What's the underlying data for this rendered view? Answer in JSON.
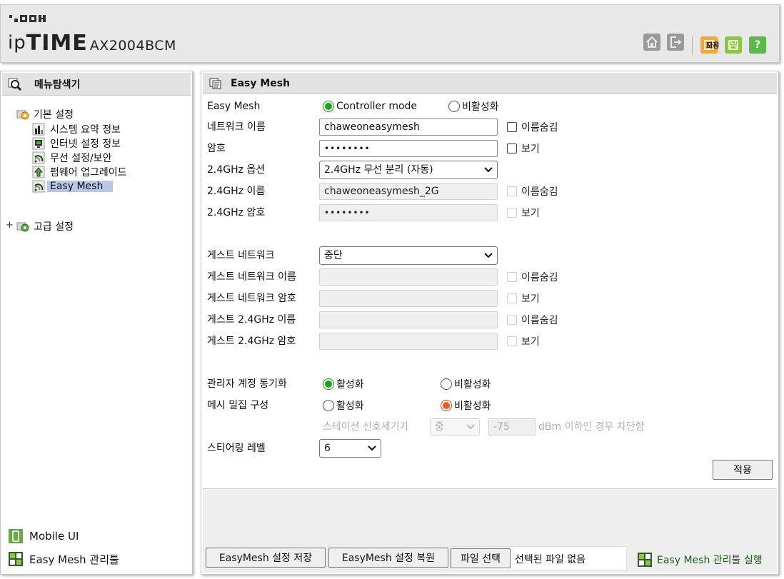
{
  "header": {
    "brand": "ipTIME",
    "brand_ip": "ip",
    "brand_time": "TIME",
    "model": "AX2004BCM",
    "nav_icons": [
      "home-icon",
      "logout-icon"
    ],
    "actions": [
      {
        "icon": "reload-icon",
        "label": "다시",
        "color": "#f0a93a"
      },
      {
        "icon": "save-icon",
        "label": "저장",
        "color": "#8cc63f"
      },
      {
        "icon": "help-icon",
        "label": "도움",
        "color": "#5cb84c"
      }
    ]
  },
  "sidebar": {
    "title": "메뉴탐색기",
    "basic": {
      "label": "기본 설정",
      "items": [
        {
          "label": "시스템 요약 정보",
          "icon": "chart-icon"
        },
        {
          "label": "인터넷 설정 정보",
          "icon": "monitor-icon"
        },
        {
          "label": "무선 설정/보안",
          "icon": "wireless-icon"
        },
        {
          "label": "펌웨어 업그레이드",
          "icon": "upgrade-icon"
        },
        {
          "label": "Easy Mesh",
          "icon": "mesh-icon",
          "selected": true
        }
      ]
    },
    "advanced": {
      "label": "고급 설정",
      "expander": "+"
    },
    "bottom": {
      "mobile_ui": "Mobile UI",
      "easymesh_tool": "Easy Mesh 관리툴"
    }
  },
  "page": {
    "title": "Easy Mesh",
    "easymesh": {
      "label": "Easy Mesh",
      "opt_controller": "Controller mode",
      "opt_disable": "비활성화",
      "selected": "Controller mode"
    },
    "network_name": {
      "label": "네트워크 이름",
      "value": "chaweoneasymesh",
      "hide_label": "이름숨김"
    },
    "password": {
      "label": "암호",
      "value": "••••••••",
      "show_label": "보기"
    },
    "opt_24": {
      "label": "2.4GHz 옵션",
      "value": "2.4GHz 무선 분리 (자동)"
    },
    "name_24": {
      "label": "2.4GHz 이름",
      "value": "chaweoneasymesh_2G",
      "hide_label": "이름숨김"
    },
    "pw_24": {
      "label": "2.4GHz 암호",
      "value": "••••••••",
      "show_label": "보기"
    },
    "guest_network": {
      "label": "게스트 네트워크",
      "value": "중단"
    },
    "guest_name": {
      "label": "게스트 네트워크 이름",
      "value": "",
      "hide_label": "이름숨김"
    },
    "guest_pw": {
      "label": "게스트 네트워크 암호",
      "value": "",
      "show_label": "보기"
    },
    "guest_name_24": {
      "label": "게스트 2.4GHz 이름",
      "value": "",
      "hide_label": "이름숨김"
    },
    "guest_pw_24": {
      "label": "게스트 2.4GHz 암호",
      "value": "",
      "show_label": "보기"
    },
    "admin_sync": {
      "label": "관리자 계정 동기화",
      "opt_on": "활성화",
      "opt_off": "비활성화",
      "selected": "활성화"
    },
    "dense_mesh": {
      "label": "메시 밀집 구성",
      "opt_on": "활성화",
      "opt_off": "비활성화",
      "selected": "비활성화"
    },
    "signal": {
      "prefix": "스테이션 신호세기가",
      "level": "중",
      "dbm": "-75",
      "suffix": "dBm 이하인 경우 차단함"
    },
    "steering": {
      "label": "스티어링 레벨",
      "value": "6"
    },
    "apply": "적용"
  },
  "footer": {
    "save_config": "EasyMesh 설정 저장",
    "restore_config": "EasyMesh 설정 복원",
    "choose_file": "파일 선택",
    "no_file": "선택된 파일 없음",
    "run_tool": "Easy Mesh 관리툴 실행"
  }
}
